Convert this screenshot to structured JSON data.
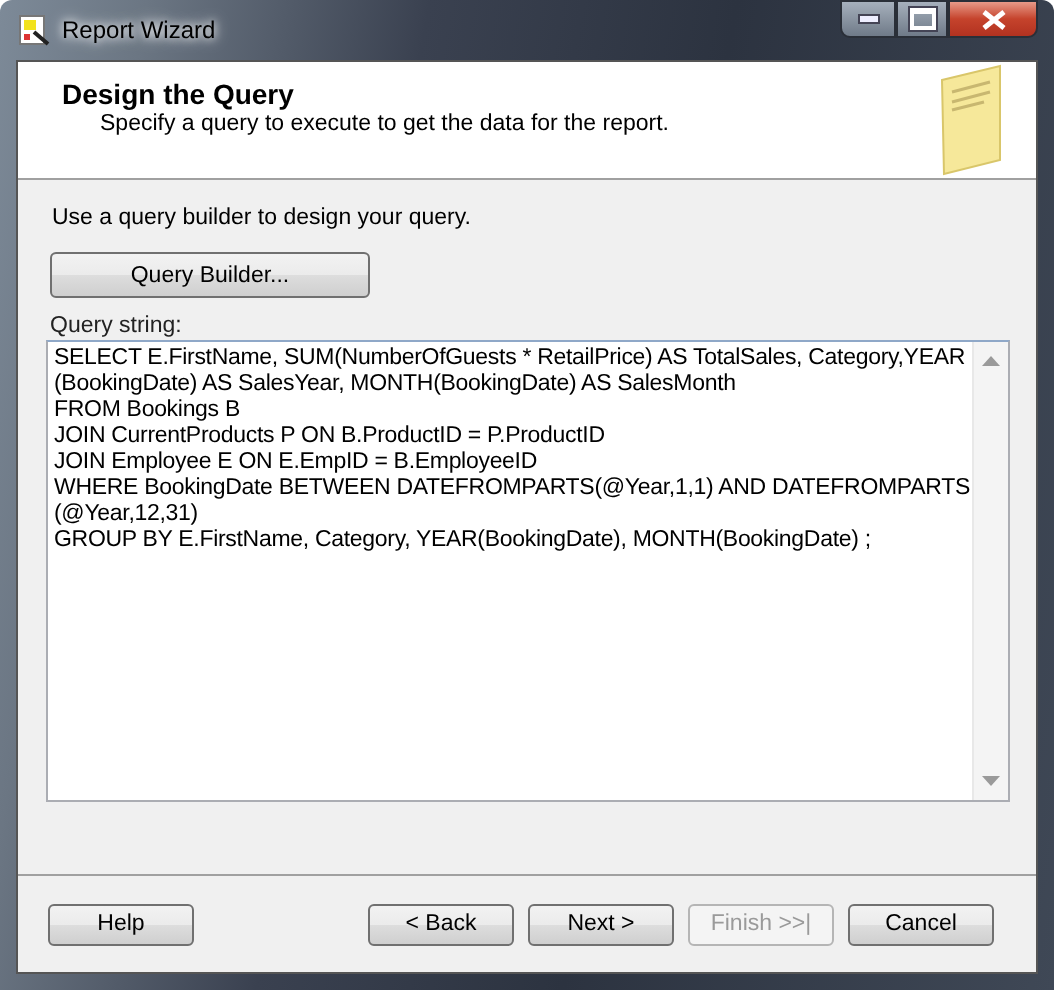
{
  "window": {
    "title": "Report Wizard"
  },
  "header": {
    "title": "Design the Query",
    "subtitle": "Specify a query to execute to get the data for the report."
  },
  "instruction": "Use a query builder to design your query.",
  "query_builder_button": {
    "label": "Query Builder...",
    "disabled": false
  },
  "query": {
    "label": "Query string:",
    "lines": [
      "SELECT E.FirstName, SUM(NumberOfGuests * RetailPrice) AS TotalSales, Category,YEAR",
      "(BookingDate) AS SalesYear, MONTH(BookingDate) AS SalesMonth",
      "FROM Bookings B",
      "JOIN CurrentProducts P ON B.ProductID = P.ProductID",
      "JOIN Employee E ON E.EmpID = B.EmployeeID",
      "WHERE BookingDate BETWEEN DATEFROMPARTS(@Year,1,1) AND DATEFROMPARTS",
      "(@Year,12,31)",
      "GROUP BY E.FirstName, Category, YEAR(BookingDate), MONTH(BookingDate) ;"
    ]
  },
  "buttons": [
    {
      "kind": "left",
      "label": "Help",
      "disabled": false
    },
    {
      "kind": "right",
      "label": "< Back",
      "disabled": false
    },
    {
      "kind": "right",
      "label": "Next >",
      "disabled": false
    },
    {
      "kind": "right",
      "label": "Finish >>|",
      "disabled": true
    },
    {
      "kind": "right",
      "label": "Cancel",
      "disabled": false
    }
  ]
}
